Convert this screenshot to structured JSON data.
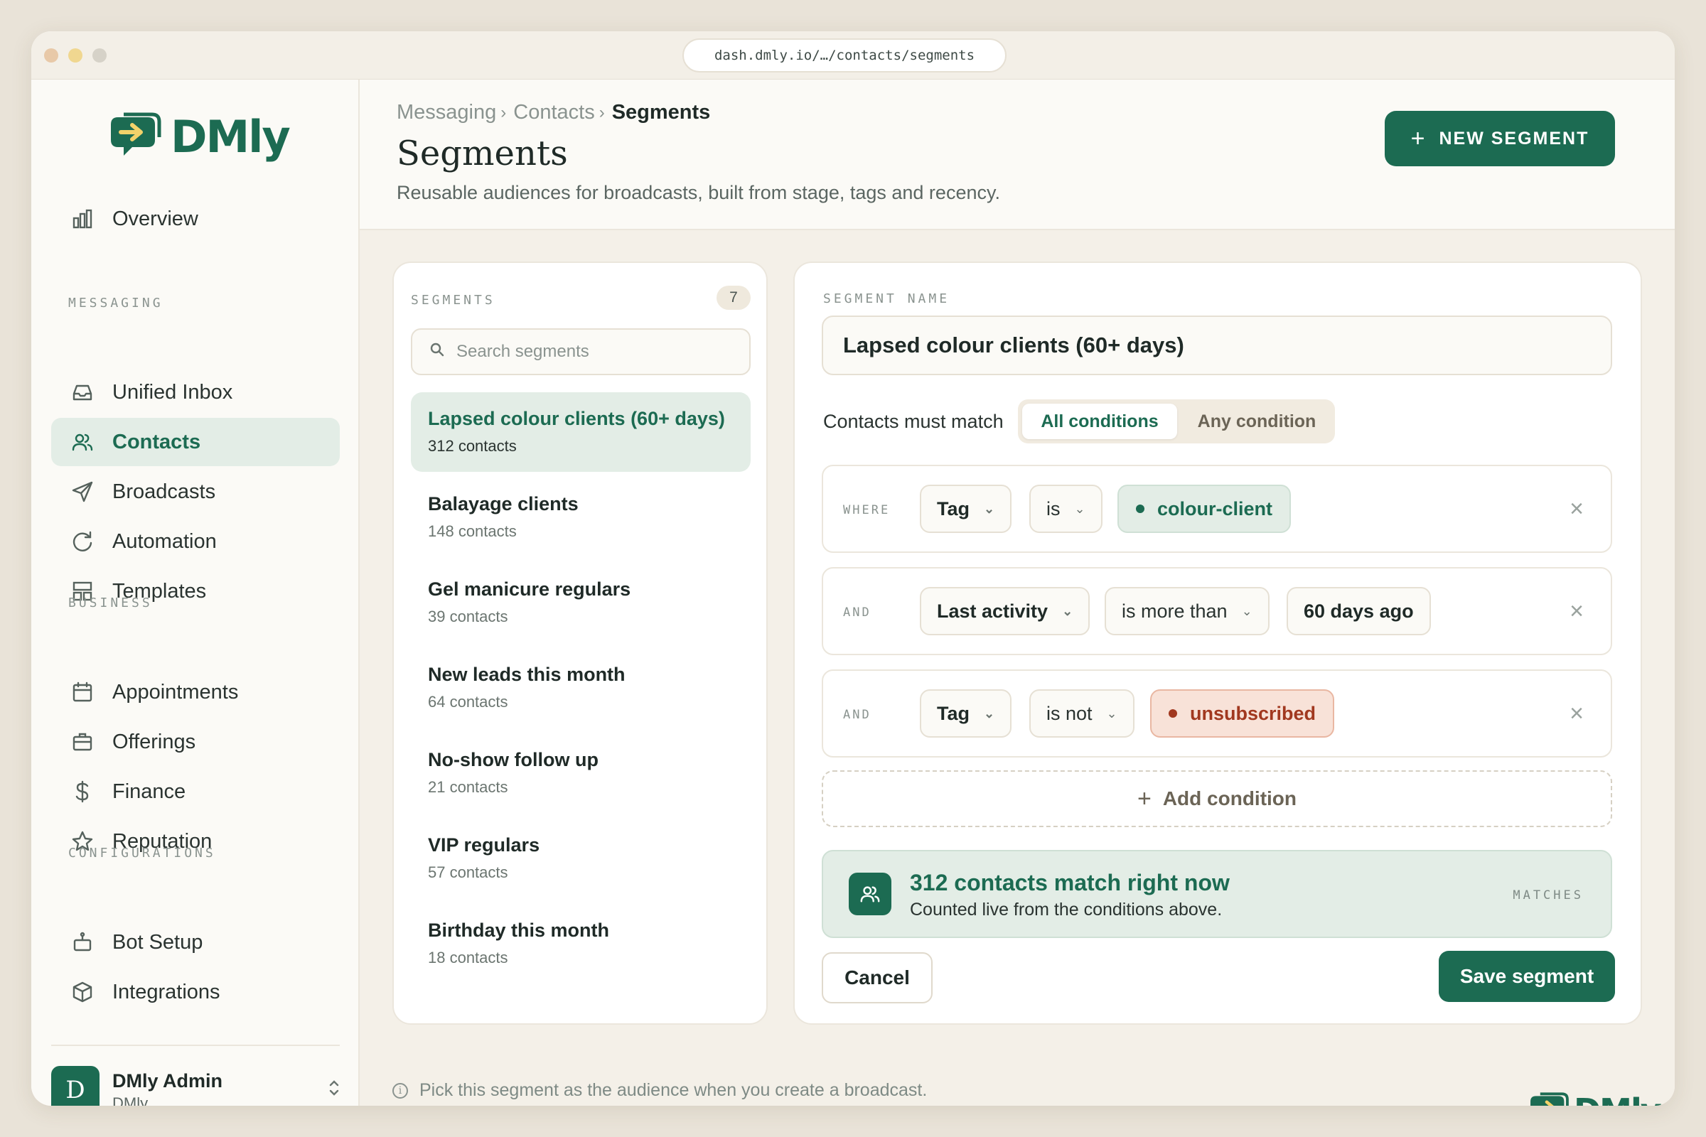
{
  "window": {
    "url": "dash.dmly.io/…/contacts/segments",
    "dots": [
      "#e8c9a8",
      "#f0d790",
      "#d6d2c8"
    ]
  },
  "brand": {
    "name": "DMly",
    "color": "#1c6b52"
  },
  "sidebar": {
    "overview": "Overview",
    "sections": {
      "messaging": "MESSAGING",
      "business": "BUSINESS",
      "configurations": "CONFIGURATIONS"
    },
    "items": [
      {
        "label": "Unified Inbox",
        "icon": "inbox-icon"
      },
      {
        "label": "Contacts",
        "icon": "contacts-icon",
        "active": true
      },
      {
        "label": "Broadcasts",
        "icon": "send-icon"
      },
      {
        "label": "Automation",
        "icon": "refresh-icon"
      },
      {
        "label": "Templates",
        "icon": "templates-icon"
      },
      {
        "label": "Appointments",
        "icon": "calendar-icon"
      },
      {
        "label": "Offerings",
        "icon": "briefcase-icon"
      },
      {
        "label": "Finance",
        "icon": "dollar-icon"
      },
      {
        "label": "Reputation",
        "icon": "star-icon"
      },
      {
        "label": "Bot Setup",
        "icon": "bot-icon"
      },
      {
        "label": "Integrations",
        "icon": "cube-icon"
      }
    ],
    "user": {
      "initial": "D",
      "name": "DMly Admin",
      "org": "DMly"
    }
  },
  "header": {
    "breadcrumbs": [
      "Messaging",
      "Contacts",
      "Segments"
    ],
    "title": "Segments",
    "subtitle": "Reusable audiences for broadcasts, built from stage, tags and recency.",
    "new_button": "NEW SEGMENT"
  },
  "segments": {
    "label": "SEGMENTS",
    "count": "7",
    "search_placeholder": "Search segments",
    "items": [
      {
        "name": "Lapsed colour clients (60+ days)",
        "count": "312 contacts",
        "active": true
      },
      {
        "name": "Balayage clients",
        "count": "148 contacts"
      },
      {
        "name": "Gel manicure regulars",
        "count": "39 contacts"
      },
      {
        "name": "New leads this month",
        "count": "64 contacts"
      },
      {
        "name": "No-show follow up",
        "count": "21 contacts"
      },
      {
        "name": "VIP regulars",
        "count": "57 contacts"
      },
      {
        "name": "Birthday this month",
        "count": "18 contacts"
      }
    ]
  },
  "editor": {
    "name_label": "SEGMENT NAME",
    "name_value": "Lapsed colour clients (60+ days)",
    "match_label": "Contacts must match",
    "match_options": [
      "All conditions",
      "Any condition"
    ],
    "match_selected": "All conditions",
    "conditions": [
      {
        "keyword": "WHERE",
        "field": "Tag",
        "operator": "is",
        "value": "colour-client",
        "value_style": "green"
      },
      {
        "keyword": "AND",
        "field": "Last activity",
        "operator": "is more than",
        "value": "60 days ago",
        "value_style": "plain"
      },
      {
        "keyword": "AND",
        "field": "Tag",
        "operator": "is not",
        "value": "unsubscribed",
        "value_style": "red"
      }
    ],
    "add_condition": "Add condition",
    "matches": {
      "title": "312 contacts match right now",
      "subtitle": "Counted live from the conditions above.",
      "tag": "MATCHES"
    },
    "cancel": "Cancel",
    "save": "Save segment"
  },
  "footer": {
    "hint": "Pick this segment as the audience when you create a broadcast."
  }
}
